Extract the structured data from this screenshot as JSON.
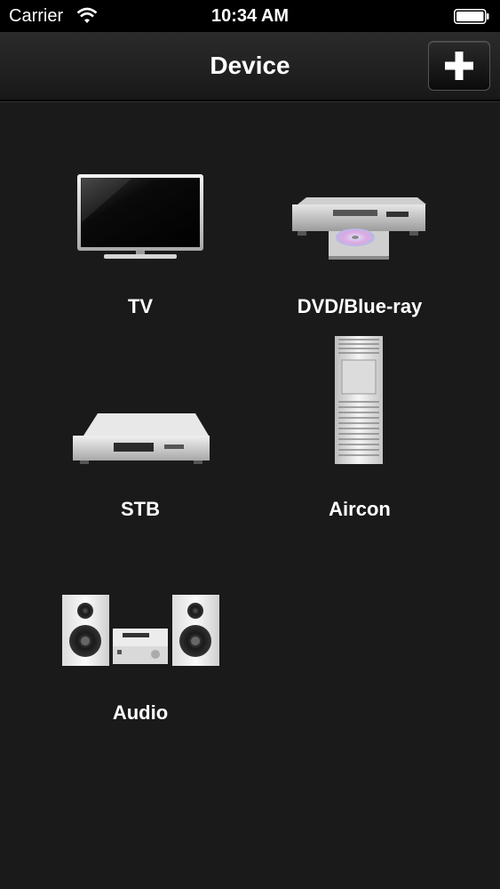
{
  "status_bar": {
    "carrier": "Carrier",
    "time": "10:34 AM"
  },
  "nav": {
    "title": "Device",
    "add_icon": "plus-icon"
  },
  "devices": [
    {
      "label": "TV",
      "icon": "tv-icon"
    },
    {
      "label": "DVD/Blue-ray",
      "icon": "dvd-player-icon"
    },
    {
      "label": "STB",
      "icon": "set-top-box-icon"
    },
    {
      "label": "Aircon",
      "icon": "air-conditioner-icon"
    },
    {
      "label": "Audio",
      "icon": "audio-system-icon"
    }
  ]
}
